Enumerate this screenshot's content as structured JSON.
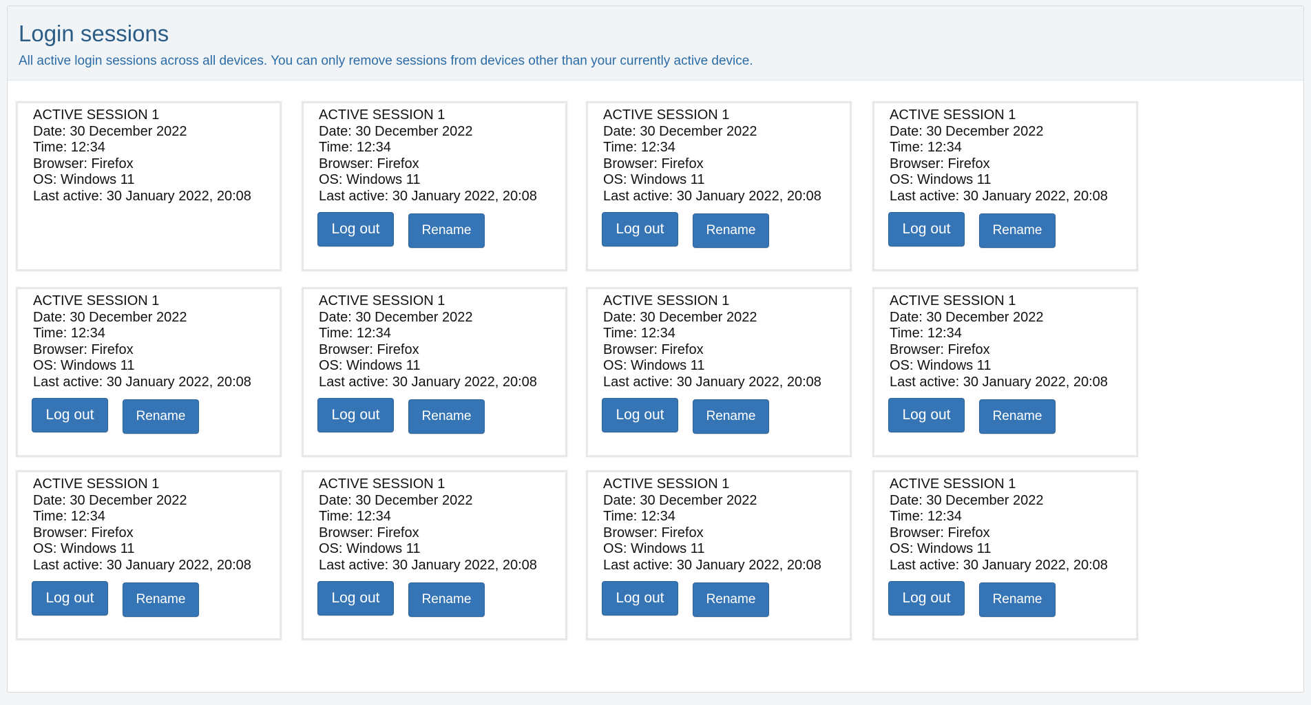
{
  "header": {
    "title": "Login sessions",
    "description": "All active login sessions across all devices. You can only remove sessions from devices other than your currently active device."
  },
  "sessions": [
    {
      "name": "ACTIVE SESSION 1",
      "date": "Date: 30 December 2022",
      "time": "Time: 12:34",
      "browser": "Browser: Firefox",
      "os": "OS: Windows 11",
      "last_active": "Last active: 30 January 2022, 20:08",
      "current": true
    },
    {
      "name": "ACTIVE SESSION 1",
      "date": "Date: 30 December 2022",
      "time": "Time: 12:34",
      "browser": "Browser: Firefox",
      "os": "OS: Windows 11",
      "last_active": "Last active: 30 January 2022, 20:08",
      "logout_label": "Log out",
      "rename_label": "Rename"
    },
    {
      "name": "ACTIVE SESSION 1",
      "date": "Date: 30 December 2022",
      "time": "Time: 12:34",
      "browser": "Browser: Firefox",
      "os": "OS: Windows 11",
      "last_active": "Last active: 30 January 2022, 20:08",
      "logout_label": "Log out",
      "rename_label": "Rename"
    },
    {
      "name": "ACTIVE SESSION 1",
      "date": "Date: 30 December 2022",
      "time": "Time: 12:34",
      "browser": "Browser: Firefox",
      "os": "OS: Windows 11",
      "last_active": "Last active: 30 January 2022, 20:08",
      "logout_label": "Log out",
      "rename_label": "Rename"
    },
    {
      "name": "ACTIVE SESSION 1",
      "date": "Date: 30 December 2022",
      "time": "Time: 12:34",
      "browser": "Browser: Firefox",
      "os": "OS: Windows 11",
      "last_active": "Last active: 30 January 2022, 20:08",
      "logout_label": "Log out",
      "rename_label": "Rename"
    },
    {
      "name": "ACTIVE SESSION 1",
      "date": "Date: 30 December 2022",
      "time": "Time: 12:34",
      "browser": "Browser: Firefox",
      "os": "OS: Windows 11",
      "last_active": "Last active: 30 January 2022, 20:08",
      "logout_label": "Log out",
      "rename_label": "Rename"
    },
    {
      "name": "ACTIVE SESSION 1",
      "date": "Date: 30 December 2022",
      "time": "Time: 12:34",
      "browser": "Browser: Firefox",
      "os": "OS: Windows 11",
      "last_active": "Last active: 30 January 2022, 20:08",
      "logout_label": "Log out",
      "rename_label": "Rename"
    },
    {
      "name": "ACTIVE SESSION 1",
      "date": "Date: 30 December 2022",
      "time": "Time: 12:34",
      "browser": "Browser: Firefox",
      "os": "OS: Windows 11",
      "last_active": "Last active: 30 January 2022, 20:08",
      "logout_label": "Log out",
      "rename_label": "Rename"
    },
    {
      "name": "ACTIVE SESSION 1",
      "date": "Date: 30 December 2022",
      "time": "Time: 12:34",
      "browser": "Browser: Firefox",
      "os": "OS: Windows 11",
      "last_active": "Last active: 30 January 2022, 20:08",
      "logout_label": "Log out",
      "rename_label": "Rename"
    },
    {
      "name": "ACTIVE SESSION 1",
      "date": "Date: 30 December 2022",
      "time": "Time: 12:34",
      "browser": "Browser: Firefox",
      "os": "OS: Windows 11",
      "last_active": "Last active: 30 January 2022, 20:08",
      "logout_label": "Log out",
      "rename_label": "Rename"
    },
    {
      "name": "ACTIVE SESSION 1",
      "date": "Date: 30 December 2022",
      "time": "Time: 12:34",
      "browser": "Browser: Firefox",
      "os": "OS: Windows 11",
      "last_active": "Last active: 30 January 2022, 20:08",
      "logout_label": "Log out",
      "rename_label": "Rename"
    },
    {
      "name": "ACTIVE SESSION 1",
      "date": "Date: 30 December 2022",
      "time": "Time: 12:34",
      "browser": "Browser: Firefox",
      "os": "OS: Windows 11",
      "last_active": "Last active: 30 January 2022, 20:08",
      "logout_label": "Log out",
      "rename_label": "Rename"
    }
  ],
  "colors": {
    "title": "#2b5c86",
    "description": "#2b6ca6",
    "button": "#3574b5"
  }
}
